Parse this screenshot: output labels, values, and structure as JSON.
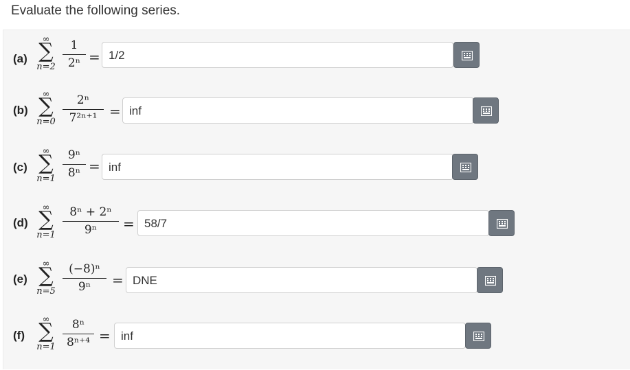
{
  "prompt": "Evaluate the following series.",
  "icon": "keyboard-grid-icon",
  "colors": {
    "panel": "#f6f6f6",
    "button": "#6f7780"
  },
  "problems": [
    {
      "label": "(a)",
      "upper": "∞",
      "lower": "n=2",
      "num": "1",
      "den": "2ⁿ",
      "answer": "1/2"
    },
    {
      "label": "(b)",
      "upper": "∞",
      "lower": "n=0",
      "num": "2ⁿ",
      "den": "7²ⁿ⁺¹",
      "answer": "inf"
    },
    {
      "label": "(c)",
      "upper": "∞",
      "lower": "n=1",
      "num": "9ⁿ",
      "den": "8ⁿ",
      "answer": "inf"
    },
    {
      "label": "(d)",
      "upper": "∞",
      "lower": "n=1",
      "num": "8ⁿ + 2ⁿ",
      "den": "9ⁿ",
      "answer": "58/7"
    },
    {
      "label": "(e)",
      "upper": "∞",
      "lower": "n=5",
      "num": "(−8)ⁿ",
      "den": "9ⁿ",
      "answer": "DNE"
    },
    {
      "label": "(f)",
      "upper": "∞",
      "lower": "n=1",
      "num": "8ⁿ",
      "den": "8ⁿ⁺⁴",
      "answer": "inf"
    }
  ]
}
